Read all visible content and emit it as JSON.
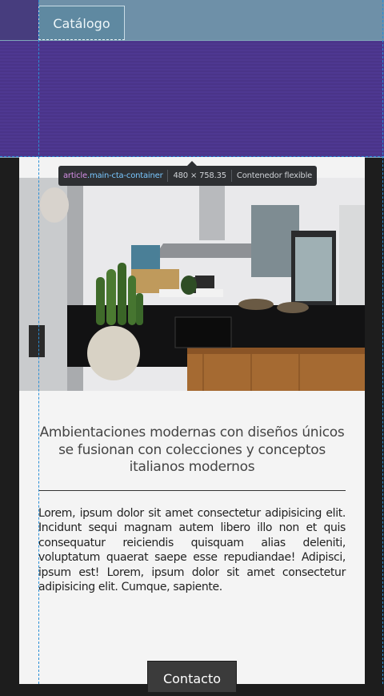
{
  "nav": {
    "tab_label": "Catálogo"
  },
  "inspector": {
    "tag": "article",
    "class_name": ".main-cta-container",
    "size": "480 × 758.35",
    "note": "Contenedor flexible"
  },
  "hero": {
    "image_alt": "Cocina moderna con isla negra y cactus"
  },
  "content": {
    "headline": "Ambientaciones modernas con diseños únicos se fusionan con colecciones y conceptos italianos modernos",
    "body": "Lorem, ipsum dolor sit amet consectetur adipisicing elit. Incidunt sequi magnam autem libero illo non et quis consequatur reiciendis quisquam alias deleniti, voluptatum quaerat saepe esse repudiandae! Adipisci, ipsum est! Lorem, ipsum dolor sit amet consectetur adipisicing elit. Cumque, sapiente.",
    "cta_label": "Contacto"
  },
  "colors": {
    "topbar": "#6e90a8",
    "overlay_purple": "#4e3891",
    "card_bg": "#f4f4f4",
    "guide": "#2a8fd6"
  }
}
